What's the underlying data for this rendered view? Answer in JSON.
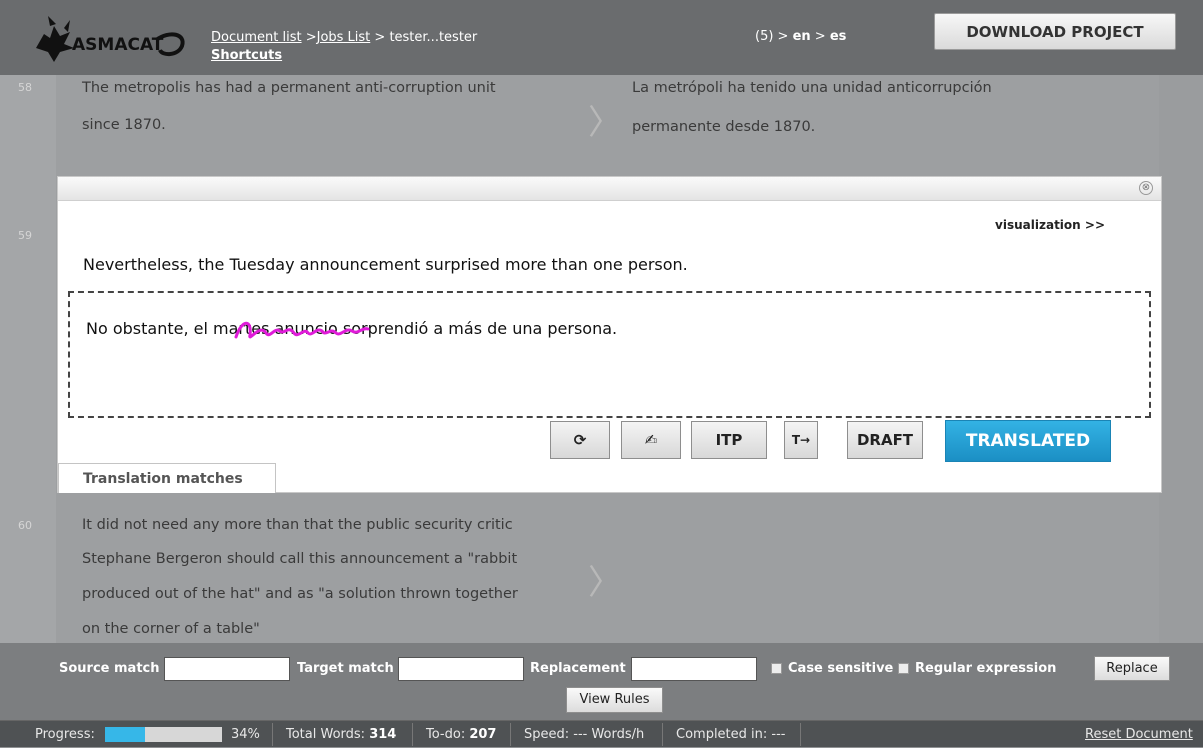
{
  "header": {
    "logo_text": "CASMACAT",
    "crumb_documents": "Document list",
    "crumb_sep1": " >",
    "crumb_jobs": "Jobs List",
    "crumb_rest": " > tester...tester",
    "shortcuts": "Shortcuts",
    "lang_prefix": "(5) > ",
    "lang_src": "en",
    "lang_sep": " > ",
    "lang_tgt": "es",
    "download_label": "DOWNLOAD PROJECT"
  },
  "segments": [
    {
      "num": "58",
      "src_line1": "The metropolis has had a permanent anti-corruption unit",
      "src_line2": "since 1870.",
      "tgt_line1": "La metrópoli ha tenido una unidad anticorrupción",
      "tgt_line2": "permanente desde 1870."
    },
    {
      "num": "59"
    },
    {
      "num": "60",
      "src_lines": [
        "It did not need any more than that the public security critic",
        "Stephane Bergeron should call this announcement a \"rabbit",
        "produced out of the hat\" and as \"a solution thrown together",
        "on the corner of a table\""
      ]
    }
  ],
  "editor": {
    "close": "⊗",
    "visualization": "visualization >>",
    "source": "Nevertheless, the Tuesday announcement surprised more than one person.",
    "target_before": "No obstante, el ",
    "target_struck": "martes anuncio",
    "target_after": " sorprendió a más de una persona.",
    "tools": {
      "refresh": "⟳",
      "pen": "✍",
      "itp": "ITP",
      "t_arrow": "T→",
      "draft": "DRAFT",
      "translated": "TRANSLATED"
    },
    "matches_tab": "Translation matches"
  },
  "search": {
    "source_label": "Source match",
    "target_label": "Target match",
    "replacement_label": "Replacement",
    "case_label": "Case sensitive",
    "regex_label": "Regular expression",
    "replace_btn": "Replace",
    "view_rules_btn": "View Rules",
    "source_value": "",
    "target_value": "",
    "replacement_value": ""
  },
  "status": {
    "progress_label": "Progress:",
    "progress_value": 0.34,
    "progress_pct": "34%",
    "total_label": "Total Words:",
    "total_value": "314",
    "todo_label": "To-do:",
    "todo_value": "207",
    "speed": "Speed: --- Words/h",
    "completed": "Completed in: ---",
    "reset": "Reset Document"
  },
  "colors": {
    "accent": "#1b8fc4",
    "scribble": "#e01bd9"
  }
}
